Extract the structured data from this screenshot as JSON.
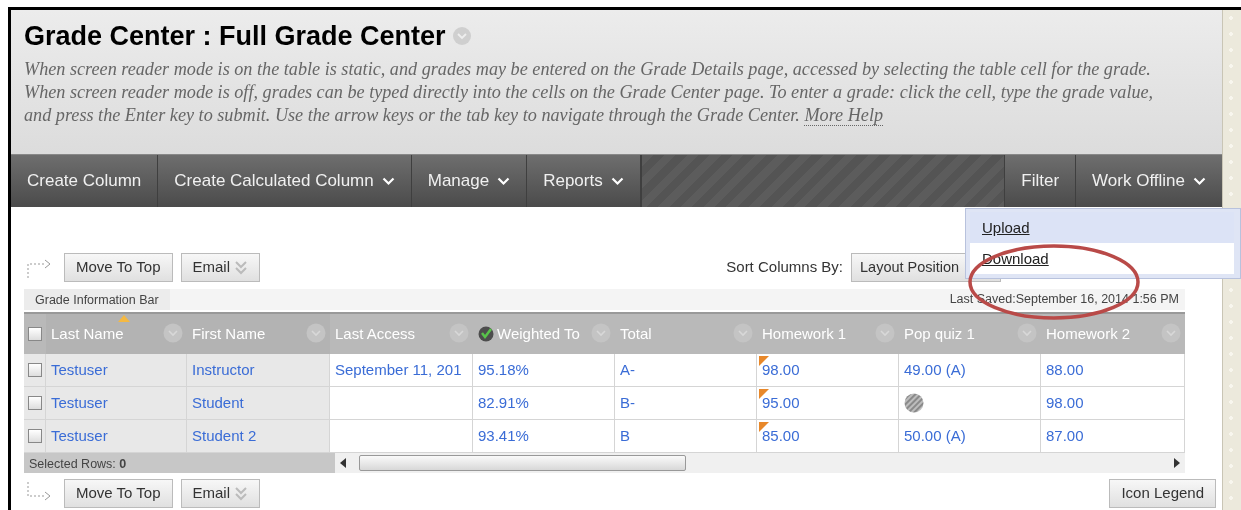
{
  "page": {
    "title": "Grade Center : Full Grade Center",
    "description": [
      "When screen reader mode is on the table is static, and grades may be entered on the Grade Details page, accessed by selecting the table cell for the grade.",
      "When screen reader mode is off, grades can be typed directly into the cells on the Grade Center page. To enter a grade: click the cell, type the grade value, and press the Enter key to submit. Use the arrow keys or the tab key to navigate through the Grade Center."
    ],
    "help_link": "More Help"
  },
  "action_bar": {
    "left": [
      {
        "label": "Create Column",
        "has_menu": false
      },
      {
        "label": "Create Calculated Column",
        "has_menu": true
      },
      {
        "label": "Manage",
        "has_menu": true
      },
      {
        "label": "Reports",
        "has_menu": true
      }
    ],
    "right": [
      {
        "label": "Filter",
        "has_menu": false
      },
      {
        "label": "Work Offline",
        "has_menu": true
      }
    ]
  },
  "offline_menu": {
    "items": [
      {
        "label": "Upload",
        "selected": true,
        "circled": false
      },
      {
        "label": "Download",
        "selected": false,
        "circled": true
      }
    ]
  },
  "top_toolbar": {
    "buttons": [
      {
        "label": "Move To Top",
        "kind": "plain"
      },
      {
        "label": "Email",
        "kind": "menu"
      }
    ],
    "sort_label": "Sort Columns By:",
    "sort_value": "Layout Position"
  },
  "info_bar": {
    "tab": "Grade Information Bar",
    "last_saved": "Last Saved:September 16, 2014 1:56 PM"
  },
  "grid": {
    "select_all": {
      "checked": false
    },
    "columns": [
      {
        "label": "Last Name",
        "sorted": true,
        "weighted": false,
        "frozen": true
      },
      {
        "label": "First Name",
        "sorted": false,
        "weighted": false,
        "frozen": true
      },
      {
        "label": "Last Access",
        "sorted": false,
        "weighted": false,
        "frozen": false
      },
      {
        "label": "Weighted To",
        "sorted": false,
        "weighted": true,
        "frozen": false
      },
      {
        "label": "Total",
        "sorted": false,
        "weighted": false,
        "frozen": false
      },
      {
        "label": "Homework 1",
        "sorted": false,
        "weighted": false,
        "frozen": false
      },
      {
        "label": "Pop quiz 1",
        "sorted": false,
        "weighted": false,
        "frozen": false
      },
      {
        "label": "Homework 2",
        "sorted": false,
        "weighted": false,
        "frozen": false
      }
    ],
    "rows": [
      {
        "selected": false,
        "cells": [
          {
            "kind": "text",
            "text": "Testuser",
            "flag": false
          },
          {
            "kind": "text",
            "text": "Instructor",
            "flag": false
          },
          {
            "kind": "text",
            "text": "September 11, 201",
            "flag": false
          },
          {
            "kind": "text",
            "text": "95.18%",
            "flag": false
          },
          {
            "kind": "text",
            "text": "A-",
            "flag": false
          },
          {
            "kind": "text",
            "text": "98.00",
            "flag": true
          },
          {
            "kind": "text",
            "text": "49.00 (A)",
            "flag": false
          },
          {
            "kind": "text",
            "text": "88.00",
            "flag": false
          }
        ]
      },
      {
        "selected": false,
        "cells": [
          {
            "kind": "text",
            "text": "Testuser",
            "flag": false
          },
          {
            "kind": "text",
            "text": "Student",
            "flag": false
          },
          {
            "kind": "empty",
            "flag": false
          },
          {
            "kind": "text",
            "text": "82.91%",
            "flag": false
          },
          {
            "kind": "text",
            "text": "B-",
            "flag": false
          },
          {
            "kind": "text",
            "text": "95.00",
            "flag": true
          },
          {
            "kind": "exempt",
            "flag": false
          },
          {
            "kind": "text",
            "text": "98.00",
            "flag": false
          }
        ]
      },
      {
        "selected": false,
        "cells": [
          {
            "kind": "text",
            "text": "Testuser",
            "flag": false
          },
          {
            "kind": "text",
            "text": "Student 2",
            "flag": false
          },
          {
            "kind": "empty",
            "flag": false
          },
          {
            "kind": "text",
            "text": "93.41%",
            "flag": false
          },
          {
            "kind": "text",
            "text": "B",
            "flag": false
          },
          {
            "kind": "text",
            "text": "85.00",
            "flag": true
          },
          {
            "kind": "text",
            "text": "50.00 (A)",
            "flag": false
          },
          {
            "kind": "text",
            "text": "87.00",
            "flag": false
          }
        ]
      }
    ],
    "selected_label": "Selected Rows:",
    "selected_count": "0"
  },
  "bottom_toolbar": {
    "buttons": [
      {
        "label": "Move To Top",
        "kind": "plain"
      },
      {
        "label": "Email",
        "kind": "menu"
      }
    ],
    "legend_button": "Icon Legend"
  }
}
